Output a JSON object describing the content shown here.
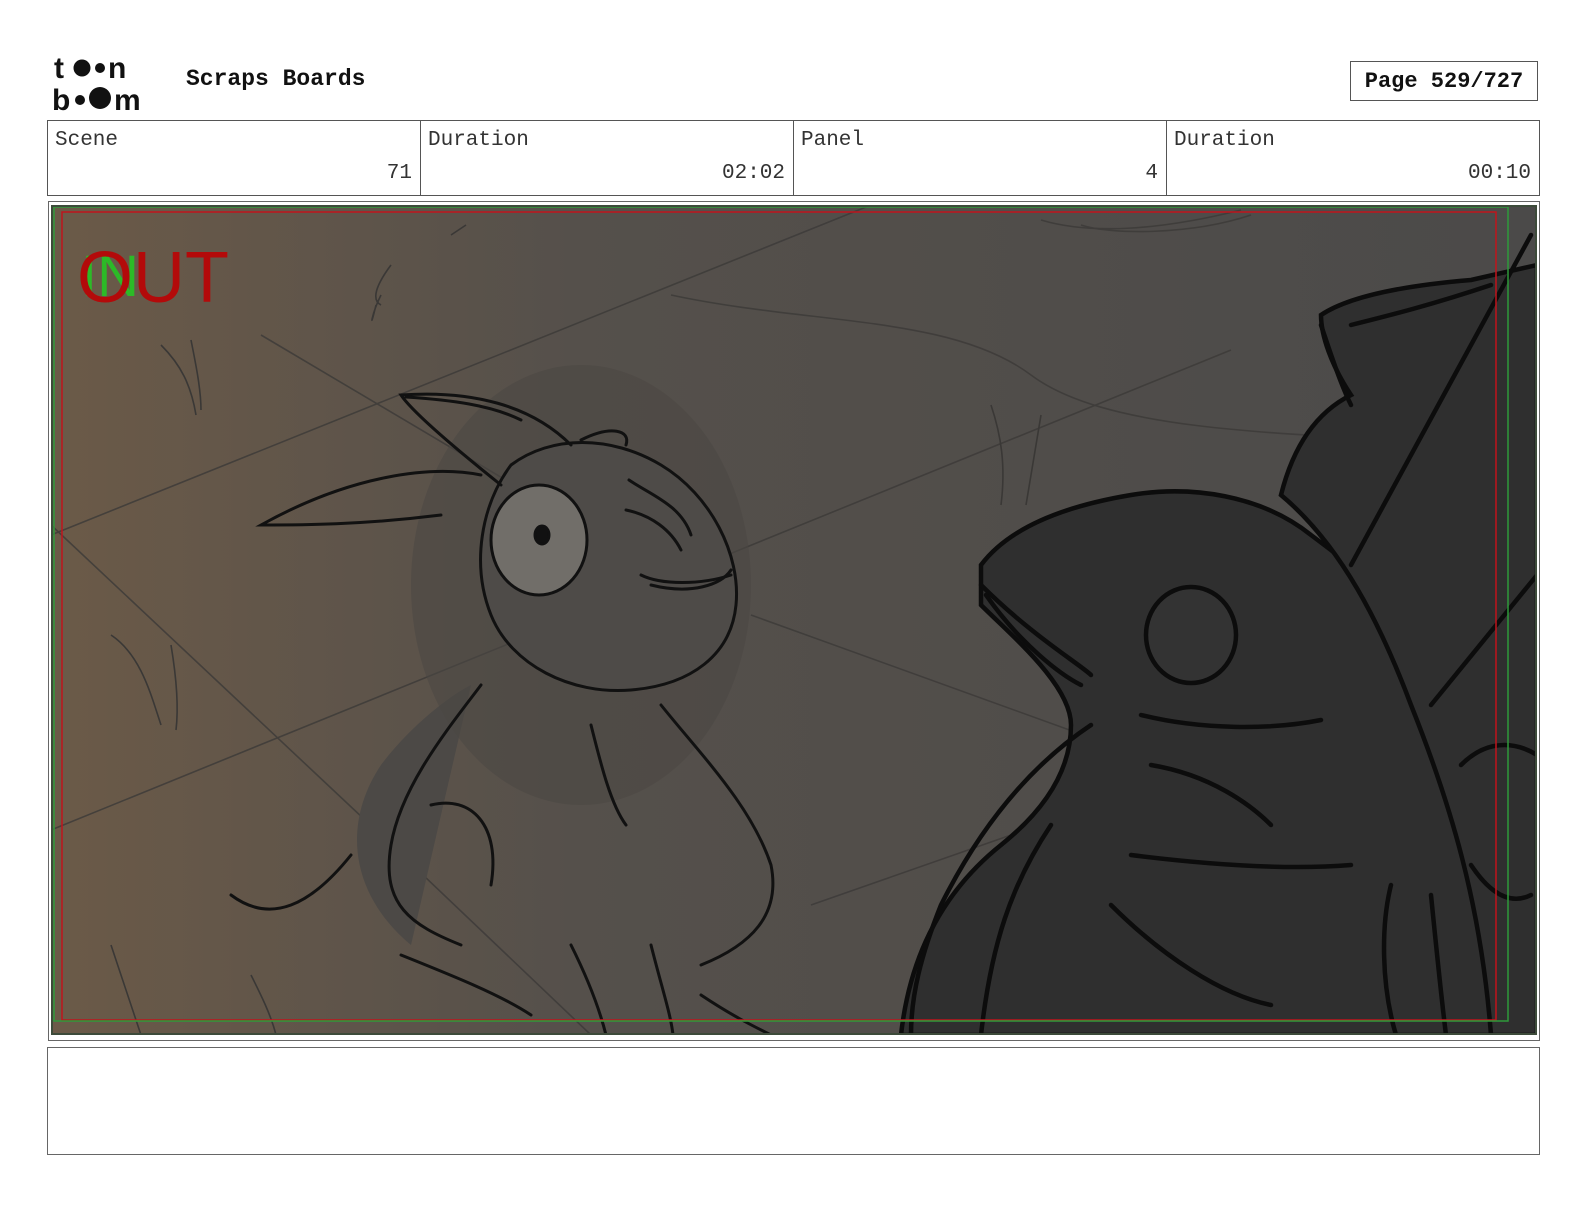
{
  "header": {
    "logo_text": [
      "toon",
      "boom"
    ],
    "project_title": "Scraps Boards",
    "page_label": "Page 529/727"
  },
  "info": {
    "scene_label": "Scene",
    "scene_value": "71",
    "scene_duration_label": "Duration",
    "scene_duration_value": "02:02",
    "panel_label": "Panel",
    "panel_value": "4",
    "panel_duration_label": "Duration",
    "panel_duration_value": "00:10"
  },
  "panel": {
    "in_marker": "IN",
    "out_marker": "OUT",
    "colors": {
      "background_dark": "#4a4846",
      "background_warm": "#6b5a48",
      "frame_red": "#c0141c",
      "frame_green": "#2e9a3a",
      "ink": "#111111",
      "big_creature_fill": "#2e2e2e"
    }
  },
  "notes": {
    "text": ""
  }
}
